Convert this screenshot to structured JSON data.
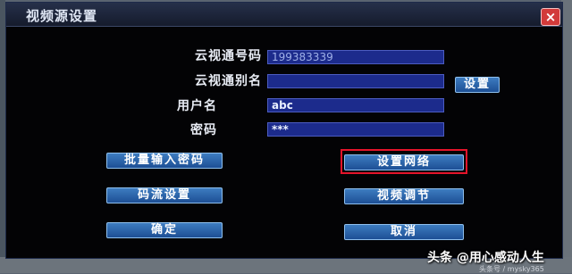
{
  "dialog": {
    "title": "视频源设置",
    "close_label": "×"
  },
  "form": {
    "cloud_id_label": "云视通号码",
    "cloud_id_value": "199383339",
    "alias_label": "云视通别名",
    "alias_value": "",
    "username_label": "用户名",
    "username_value": "abc",
    "password_label": "密码",
    "password_value": "***",
    "alias_set_button": "设置"
  },
  "buttons": {
    "batch_password": "批量输入密码",
    "network_settings": "设置网络",
    "stream_settings": "码流设置",
    "video_adjust": "视频调节",
    "ok": "确定",
    "cancel": "取消"
  },
  "watermark": {
    "main": "头条 @用心感动人生",
    "sub": "头条号 / mysky365"
  },
  "colors": {
    "highlight": "#e4142a",
    "field_bg": "#1c2b8c",
    "button_bg": "#2d66ab"
  }
}
